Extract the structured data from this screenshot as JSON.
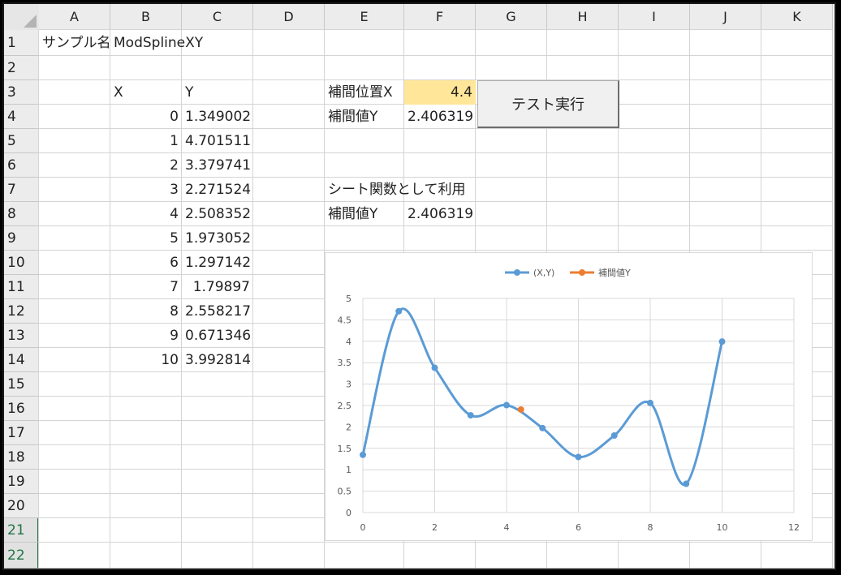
{
  "columns": [
    "A",
    "B",
    "C",
    "D",
    "E",
    "F",
    "G",
    "H",
    "I",
    "J",
    "K"
  ],
  "rows": [
    "1",
    "2",
    "3",
    "4",
    "5",
    "6",
    "7",
    "8",
    "9",
    "10",
    "11",
    "12",
    "13",
    "14",
    "15",
    "16",
    "17",
    "18",
    "19",
    "20",
    "21",
    "22"
  ],
  "selected_rows": [
    "21",
    "22"
  ],
  "cells": {
    "a1": "サンプル名",
    "b1": "ModSplineXY",
    "b3": "X",
    "c3": "Y",
    "e3": "補間位置X",
    "f3": "4.4",
    "e4": "補間値Y",
    "f4": "2.406319",
    "e7": "シート関数として利用",
    "e8": "補間値Y",
    "f8": "2.406319"
  },
  "table": {
    "x": [
      "0",
      "1",
      "2",
      "3",
      "4",
      "5",
      "6",
      "7",
      "8",
      "9",
      "10"
    ],
    "y": [
      "1.349002",
      "4.701511",
      "3.379741",
      "2.271524",
      "2.508352",
      "1.973052",
      "1.297142",
      "1.79897",
      "2.558217",
      "0.671346",
      "3.992814"
    ]
  },
  "button": {
    "label": "テスト実行"
  },
  "colors": {
    "series": "#5b9bd5",
    "point": "#ed7d31",
    "highlight": "#ffe699",
    "grid": "#d9d9d9"
  },
  "chart_data": {
    "type": "scatter",
    "smooth": true,
    "legend_position": "top",
    "xlim": [
      0,
      12
    ],
    "ylim": [
      0,
      5
    ],
    "x_ticks": [
      "0",
      "2",
      "4",
      "6",
      "8",
      "10",
      "12"
    ],
    "y_ticks": [
      "0",
      "0.5",
      "1",
      "1.5",
      "2",
      "2.5",
      "3",
      "3.5",
      "4",
      "4.5",
      "5"
    ],
    "grid": true,
    "series": [
      {
        "name": "(X,Y)",
        "x": [
          0,
          1,
          2,
          3,
          4,
          5,
          6,
          7,
          8,
          9,
          10
        ],
        "y": [
          1.349002,
          4.701511,
          3.379741,
          2.271524,
          2.508352,
          1.973052,
          1.297142,
          1.79897,
          2.558217,
          0.671346,
          3.992814
        ]
      },
      {
        "name": "補間値Y",
        "x": [
          4.4
        ],
        "y": [
          2.406319
        ]
      }
    ]
  }
}
